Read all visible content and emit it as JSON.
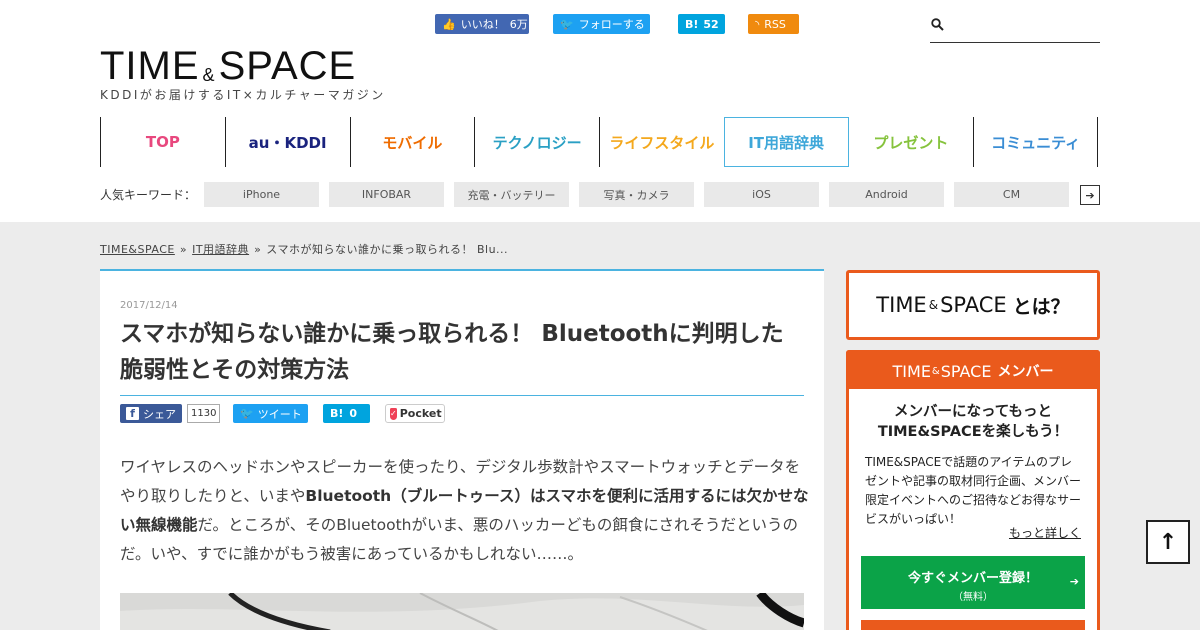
{
  "header": {
    "logo": {
      "left": "TIME",
      "amp": "&",
      "right": "SPACE"
    },
    "tagline": "KDDIがお届けするIT×カルチャーマガジン",
    "social": {
      "facebook": {
        "label": "いいね！",
        "count": "6万"
      },
      "twitter": {
        "label": "フォローする"
      },
      "hatena": {
        "label": "B!",
        "count": "52"
      },
      "rss": {
        "label": "RSS"
      }
    },
    "search": {
      "placeholder": ""
    }
  },
  "nav": {
    "items": [
      {
        "label": "TOP",
        "color": "#e8487e"
      },
      {
        "label": "au・KDDI",
        "color": "#1a237e"
      },
      {
        "label": "モバイル",
        "color": "#ef6c00"
      },
      {
        "label": "テクノロジー",
        "color": "#2aa0c4"
      },
      {
        "label": "ライフスタイル",
        "color": "#f4a81d"
      },
      {
        "label": "IT用語辞典",
        "color": "#3ea7d9"
      },
      {
        "label": "プレゼント",
        "color": "#86c33d"
      },
      {
        "label": "コミュニティ",
        "color": "#3a8dd4"
      }
    ]
  },
  "keywords": {
    "label": "人気キーワード：",
    "items": [
      "iPhone",
      "INFOBAR",
      "充電・バッテリー",
      "写真・カメラ",
      "iOS",
      "Android",
      "CM"
    ],
    "next": "➔"
  },
  "breadcrumb": {
    "home": "TIME&SPACE",
    "category": "IT用語辞典",
    "current": "スマホが知らない誰かに乗っ取られる！ Blu...",
    "sep": "»"
  },
  "article": {
    "date": "2017/12/14",
    "title": "スマホが知らない誰かに乗っ取られる！ Bluetoothに判明した脆弱性とその対策方法",
    "share": {
      "facebook": {
        "icon": "f",
        "label": "シェア",
        "count": "1130"
      },
      "twitter": {
        "label": "ツイート"
      },
      "hatena": {
        "label": "B!",
        "count": "0"
      },
      "pocket": {
        "label": "Pocket"
      }
    },
    "body": {
      "p1": "ワイヤレスのヘッドホンやスピーカーを使ったり、デジタル歩数計やスマートウォッチとデータをやり取りしたりと、いまや",
      "p1_bold": "Bluetooth（ブルートゥース）はスマホを便利に活用するには欠かせない無線機能",
      "p2": "だ。ところが、そのBluetoothがいま、悪のハッカーどもの餌食にされそうだというのだ。いや、すでに誰かがもう被害にあっているかもしれない……。"
    }
  },
  "sidebar": {
    "about": {
      "left": "TIME",
      "amp": "&",
      "right": "SPACE",
      "suffix": "とは？"
    },
    "member": {
      "head_left": "TIME",
      "head_amp": "&",
      "head_right": "SPACE",
      "head_suffix": "メンバー",
      "lead1": "メンバーになってもっと",
      "lead2": "TIME&SPACEを楽しもう！",
      "desc": "TIME&SPACEで話題のアイテムのプレゼントや記事の取材同行企画、メンバー限定イベントへのご招待などお得なサービスがいっぱい！",
      "more": "もっと詳しく",
      "signup": "今すぐメンバー登録！",
      "signup_sub": "（無料）",
      "signup_arrow": "➔"
    }
  },
  "totop": {
    "label": "↑"
  }
}
